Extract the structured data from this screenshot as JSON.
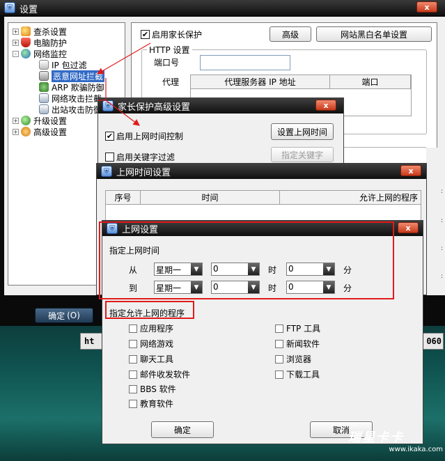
{
  "main_window": {
    "title": "设置",
    "close": "x",
    "ok_button": "确定",
    "ok_hotkey": "(O)"
  },
  "tree": {
    "items": [
      {
        "label": "查杀设置",
        "expander": "+",
        "icon": "search-shield-icon"
      },
      {
        "label": "电脑防护",
        "expander": "+",
        "icon": "shield-red-icon"
      },
      {
        "label": "网络监控",
        "expander": "-",
        "icon": "network-globe-icon"
      },
      {
        "label": "IP 包过滤",
        "icon": "ip-filter-icon"
      },
      {
        "label": "恶意网址拦截",
        "icon": "url-block-icon",
        "selected": true
      },
      {
        "label": "ARP 欺骗防御",
        "icon": "arp-icon"
      },
      {
        "label": "网络攻击拦截",
        "icon": "attack-block-icon"
      },
      {
        "label": "出站攻击防御",
        "icon": "outbound-icon"
      },
      {
        "label": "升级设置",
        "expander": "+",
        "icon": "upgrade-globe-icon"
      },
      {
        "label": "高级设置",
        "expander": "+",
        "icon": "gear-icon"
      }
    ]
  },
  "parental": {
    "enable_label": "启用家长保护",
    "enabled": true,
    "advanced_button": "高级",
    "blacklist_button": "网站黑白名单设置",
    "http_legend": "HTTP 设置",
    "port_label": "端口号",
    "port_value": "",
    "proxy_label": "代理",
    "proxy_columns": [
      "代理服务器 IP 地址",
      "端口"
    ]
  },
  "advanced_dialog": {
    "title": "家长保护高级设置",
    "close": "x",
    "time_control_label": "启用上网时间控制",
    "time_control_checked": true,
    "set_time_button": "设置上网时间",
    "keyword_filter_label": "启用关键字过滤",
    "keyword_filter_checked": false,
    "set_keyword_button": "指定关键字"
  },
  "schedule_dialog": {
    "title": "上网时间设置",
    "close": "x",
    "columns": [
      "序号",
      "时间",
      "允许上网的程序"
    ]
  },
  "online_dialog": {
    "title": "上网设置",
    "close": "x",
    "time_section": "指定上网时间",
    "from_label": "从",
    "to_label": "到",
    "hour_unit": "时",
    "minute_unit": "分",
    "from": {
      "day": "星期一",
      "hour": "0",
      "minute": "0"
    },
    "to": {
      "day": "星期一",
      "hour": "0",
      "minute": "0"
    },
    "program_section": "指定允许上网的程序",
    "programs_left": [
      "应用程序",
      "网络游戏",
      "聊天工具",
      "邮件收发软件",
      "BBS 软件",
      "教育软件"
    ],
    "programs_right": [
      "FTP 工具",
      "新闻软件",
      "浏览器",
      "下载工具"
    ],
    "ok_button": "确定",
    "cancel_button": "取消"
  },
  "background": {
    "url_fragment_left": "ht",
    "url_fragment_right": "060"
  },
  "watermark": {
    "brand": "瑞星卡卡",
    "url": "www.ikaka.com"
  },
  "colors": {
    "highlight": "#e01a1a",
    "selection": "#316ac5",
    "title_bar": "#101010"
  }
}
